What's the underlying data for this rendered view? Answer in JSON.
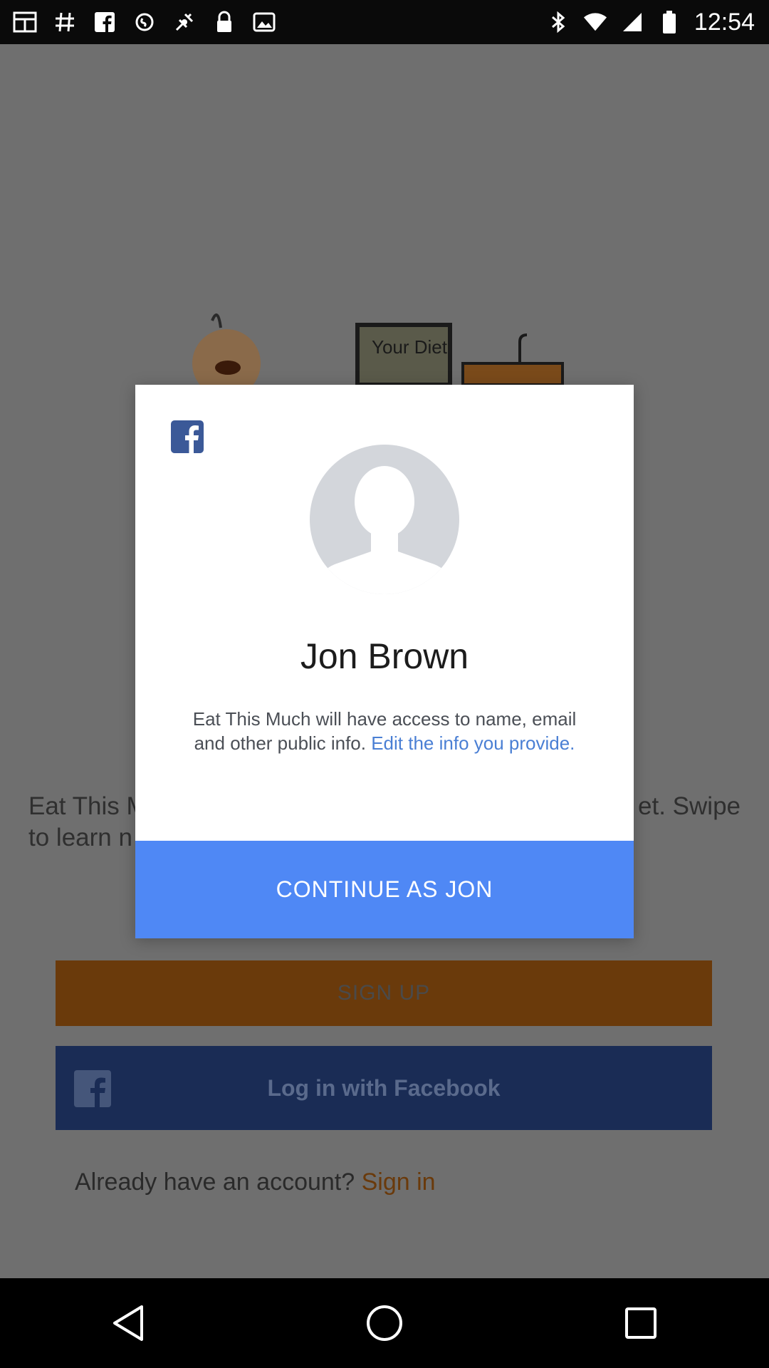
{
  "status_bar": {
    "time": "12:54",
    "left_icons": [
      "gallery-icon",
      "hashtag-icon",
      "facebook-icon",
      "shazam-icon",
      "fake-gps-icon",
      "lock-icon",
      "image-icon"
    ],
    "right_icons": [
      "bluetooth-icon",
      "wifi-icon",
      "signal-icon",
      "battery-icon"
    ]
  },
  "background": {
    "illustration_text": "Your Diet",
    "text_left": "Eat This M",
    "text_left_line2": "to learn n",
    "text_right": "et. Swipe",
    "signup_label": "SIGN UP",
    "facebook_login_label": "Log in with Facebook",
    "signin_prompt": "Already have an account?",
    "signin_link": "Sign in"
  },
  "dialog": {
    "user_name": "Jon Brown",
    "description": "Eat This Much will have access to name, email and other public info.",
    "edit_link": "Edit the info you provide.",
    "continue_label": "CONTINUE AS JON"
  },
  "colors": {
    "facebook_blue": "#3b5998",
    "continue_blue": "#4f88f5",
    "signup_brown": "#6a3a0b",
    "link_blue": "#4a7fd4"
  }
}
